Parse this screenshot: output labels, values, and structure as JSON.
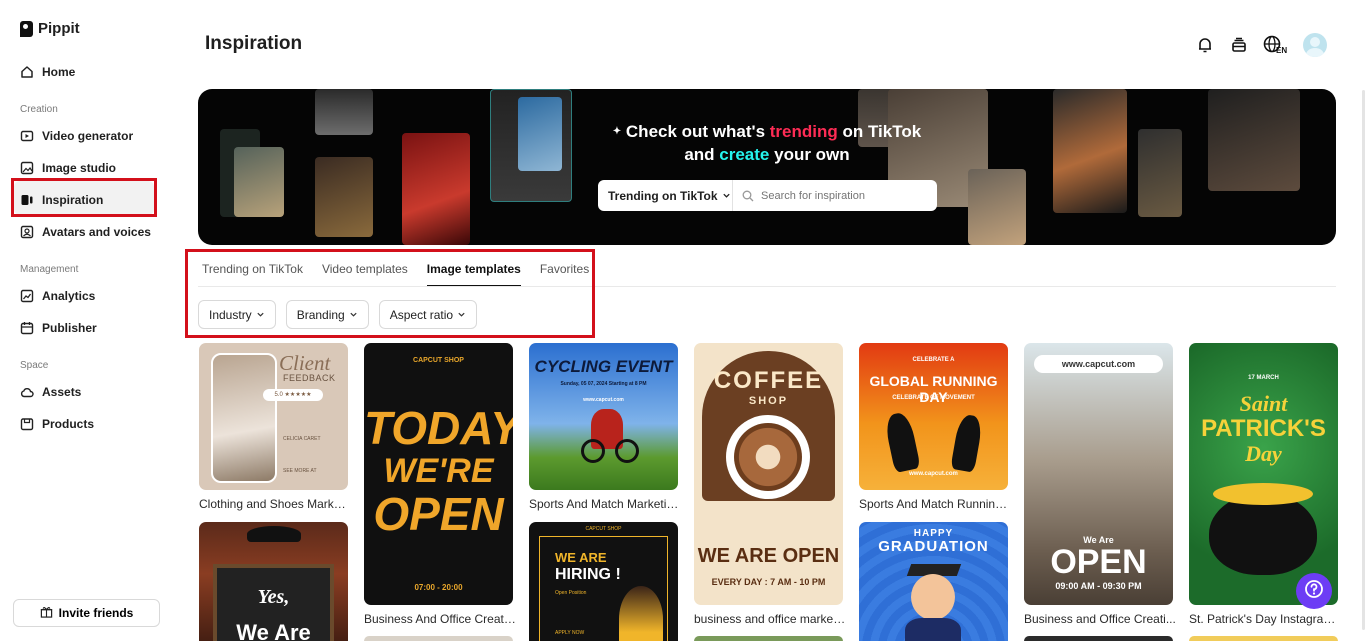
{
  "brand": {
    "name": "Pippit"
  },
  "sidebar": {
    "home": "Home",
    "sections": {
      "creation": "Creation",
      "management": "Management",
      "space": "Space"
    },
    "creation_items": [
      "Video generator",
      "Image studio",
      "Inspiration",
      "Avatars and voices"
    ],
    "management_items": [
      "Analytics",
      "Publisher"
    ],
    "space_items": [
      "Assets",
      "Products"
    ],
    "invite": "Invite friends",
    "active_item": "Inspiration"
  },
  "header": {
    "title": "Inspiration",
    "language_badge": "EN"
  },
  "banner": {
    "line1_a": "Check out what's ",
    "line1_b": "trending",
    "line1_c": " on TikTok",
    "line2_a": "and ",
    "line2_b": "create",
    "line2_c": " your own",
    "select_label": "Trending on TikTok",
    "search_placeholder": "Search for inspiration"
  },
  "tabs": [
    "Trending on TikTok",
    "Video templates",
    "Image templates",
    "Favorites"
  ],
  "active_tab": "Image templates",
  "filters": [
    "Industry",
    "Branding",
    "Aspect ratio"
  ],
  "templates": [
    {
      "caption": "Clothing and Shoes Market...",
      "text": [
        "Client",
        "FEEDBACK",
        "5.0 ★★★★★",
        "CELICIA CARET",
        "SEE MORE AT"
      ]
    },
    {
      "caption": "Business And Office Creati...",
      "text": [
        "CAPCUT SHOP",
        "TODAY",
        "WE'RE",
        "OPEN",
        "07:00 - 20:00"
      ]
    },
    {
      "caption": "Sports And Match Marketin...",
      "text": [
        "CYCLING EVENT",
        "Sunday, 05 07, 2024 Starting at 8 PM",
        "www.capcut.com"
      ]
    },
    {
      "caption": "business and office market...",
      "text": [
        "COFFEE",
        "SHOP",
        "WE ARE OPEN",
        "EVERY DAY : 7 AM - 10 PM"
      ]
    },
    {
      "caption": "Sports And Match Running ...",
      "text": [
        "CELEBRATE A",
        "GLOBAL RUNNING DAY",
        "CELEBRATE OF MOVEMENT",
        "www.capcut.com"
      ]
    },
    {
      "caption": "Business and Office Creati...",
      "text": [
        "www.capcut.com",
        "We Are",
        "OPEN",
        "09:00 AM - 09:30 PM"
      ]
    },
    {
      "caption": "St. Patrick's Day Instagram ...",
      "text": [
        "17 MARCH",
        "Saint",
        "PATRICK'S",
        "Day"
      ]
    },
    {
      "caption": "",
      "text": [
        "Yes,",
        "We Are"
      ]
    },
    {
      "caption": "",
      "text": [
        "CAPCUT SHOP",
        "WE ARE",
        "HIRING !",
        "Open Position",
        "APPLY NOW"
      ]
    },
    {
      "caption": "",
      "text": [
        "HAPPY",
        "GRADUATION"
      ]
    }
  ],
  "colors": {
    "accent_red": "#fe2c55",
    "accent_cyan": "#25f4ee",
    "highlight": "#d3101b",
    "help_button": "#6d3df5"
  }
}
